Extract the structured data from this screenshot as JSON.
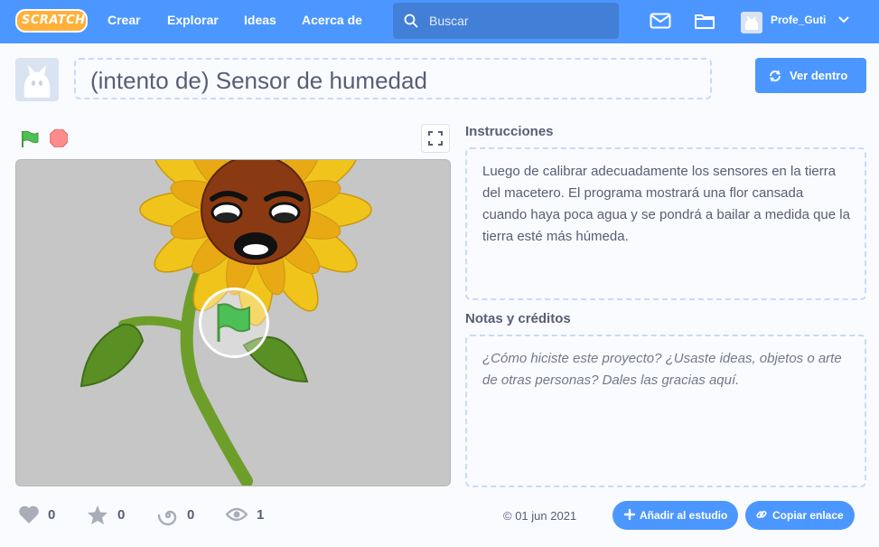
{
  "nav": {
    "logo_text": "SCRATCH",
    "links": [
      "Crear",
      "Explorar",
      "Ideas",
      "Acerca de"
    ],
    "search_placeholder": "Buscar",
    "username": "Profe_Guti"
  },
  "project": {
    "title": "(intento de) Sensor de humedad",
    "see_inside_label": "Ver dentro"
  },
  "instructions": {
    "heading": "Instrucciones",
    "text": "Luego de calibrar adecuadamente los sensores en la tierra del macetero. El programa mostrará una flor cansada cuando haya poca agua y se pondrá a bailar a medida que la tierra esté más húmeda."
  },
  "notes": {
    "heading": "Notas y créditos",
    "placeholder": "¿Cómo hiciste este proyecto? ¿Usaste ideas, objetos o arte de otras personas? Dales las gracias aquí."
  },
  "stats": {
    "loves": "0",
    "favorites": "0",
    "remixes": "0",
    "views": "1"
  },
  "date": "01 jun 2021",
  "buttons": {
    "add_to_studio": "Añadir al estudio",
    "copy_link": "Copiar enlace"
  },
  "colors": {
    "nav_blue": "#4c97ff",
    "search_blue": "#4280d7",
    "text": "#575e75",
    "dashed_border": "#c6dbf7",
    "green_flag": "#4cbf56",
    "stop_red": "#ff8c8c"
  }
}
